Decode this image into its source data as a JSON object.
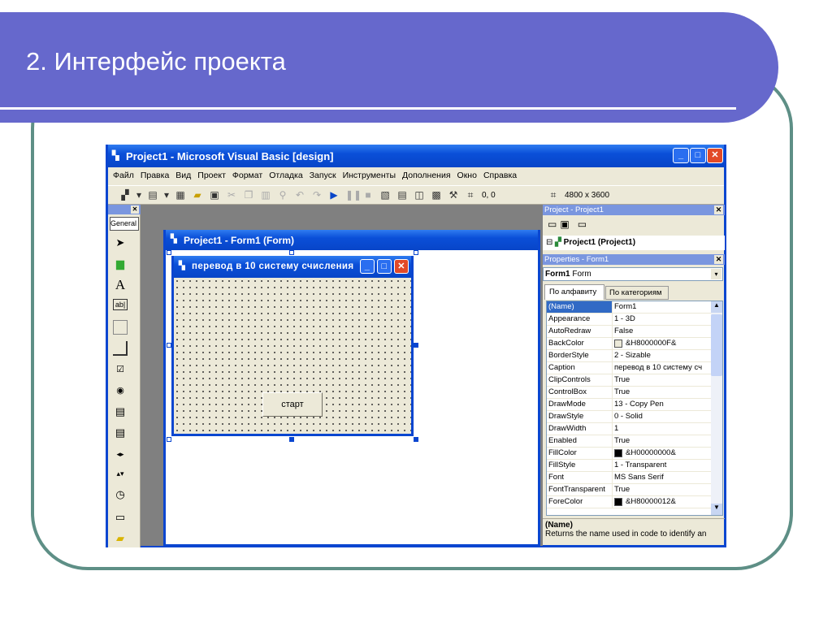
{
  "slide": {
    "title": "2. Интерфейс проекта"
  },
  "colors": {
    "band": "#6668cc",
    "frame": "#5e8f86",
    "titlebar": "#0a4fd8"
  },
  "vb": {
    "title": "Project1 - Microsoft Visual Basic [design]",
    "menu": [
      "Файл",
      "Правка",
      "Вид",
      "Проект",
      "Формат",
      "Отладка",
      "Запуск",
      "Инструменты",
      "Дополнения",
      "Окно",
      "Справка"
    ],
    "toolbar": {
      "position": "0, 0",
      "size": "4800 x 3600"
    },
    "toolbox": {
      "tab": "General",
      "tools": [
        "pointer-icon",
        "picturebox-icon",
        "label-icon",
        "textbox-icon",
        "frame-icon",
        "commandbutton-icon",
        "checkbox-icon",
        "optionbutton-icon",
        "combobox-icon",
        "listbox-icon",
        "hscrollbar-icon",
        "vscrollbar-icon",
        "timer-icon",
        "drivelistbox-icon",
        "dirlistbox-icon"
      ]
    },
    "form_window": {
      "title": "Project1 - Form1 (Form)"
    },
    "designer": {
      "caption": "перевод в 10 систему счисления",
      "button": "старт"
    },
    "project": {
      "title": "Project - Project1",
      "tree_item": "Project1 (Project1)"
    },
    "properties": {
      "title": "Properties - Form1",
      "object": "Form1",
      "object_type": "Form",
      "tabs": [
        "По алфавиту",
        "По категориям"
      ],
      "rows": [
        {
          "name": "(Name)",
          "value": "Form1"
        },
        {
          "name": "Appearance",
          "value": "1 - 3D"
        },
        {
          "name": "AutoRedraw",
          "value": "False"
        },
        {
          "name": "BackColor",
          "value": "&H8000000F&",
          "swatch": "#ece9d8"
        },
        {
          "name": "BorderStyle",
          "value": "2 - Sizable"
        },
        {
          "name": "Caption",
          "value": "перевод в 10 систему сч"
        },
        {
          "name": "ClipControls",
          "value": "True"
        },
        {
          "name": "ControlBox",
          "value": "True"
        },
        {
          "name": "DrawMode",
          "value": "13 - Copy Pen"
        },
        {
          "name": "DrawStyle",
          "value": "0 - Solid"
        },
        {
          "name": "DrawWidth",
          "value": "1"
        },
        {
          "name": "Enabled",
          "value": "True"
        },
        {
          "name": "FillColor",
          "value": "&H00000000&",
          "swatch": "#000000"
        },
        {
          "name": "FillStyle",
          "value": "1 - Transparent"
        },
        {
          "name": "Font",
          "value": "MS Sans Serif"
        },
        {
          "name": "FontTransparent",
          "value": "True"
        },
        {
          "name": "ForeColor",
          "value": "&H80000012&",
          "swatch": "#000000"
        }
      ],
      "desc_title": "(Name)",
      "desc_text": "Returns the name used in code to identify an"
    }
  }
}
